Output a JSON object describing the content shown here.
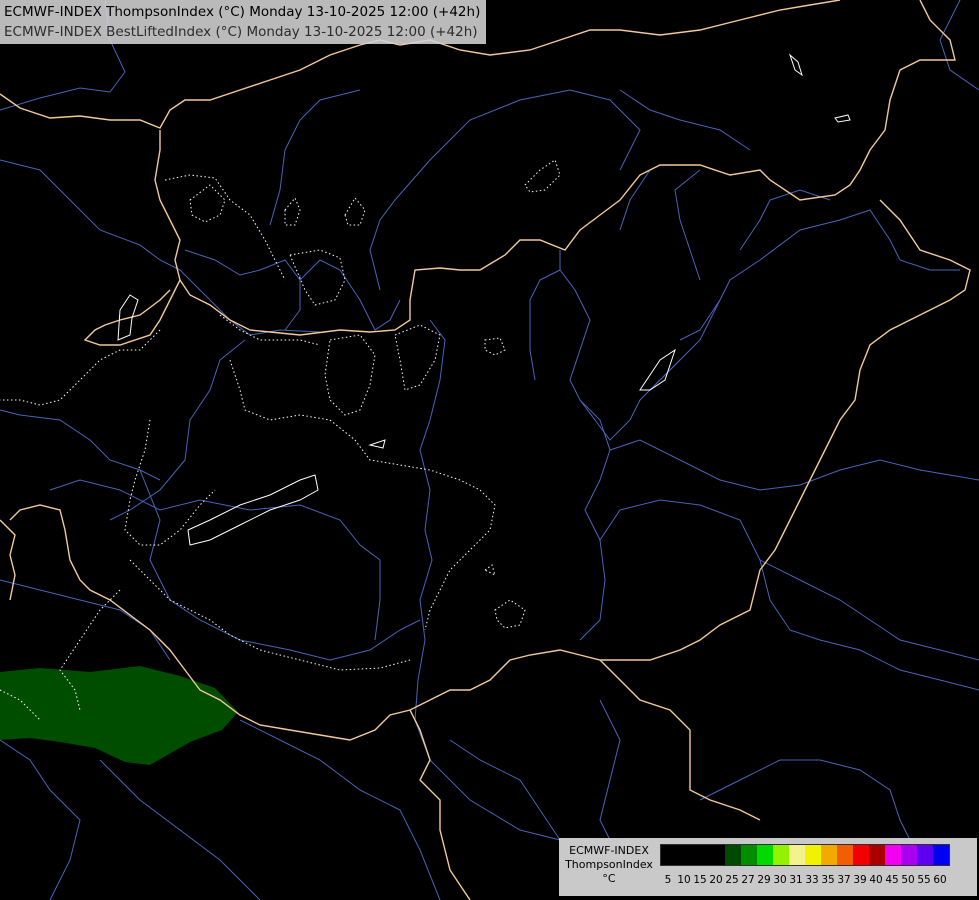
{
  "title": {
    "line1": "ECMWF-INDEX ThompsonIndex (°C) Monday 13-10-2025 12:00 (+42h)",
    "line2": "ECMWF-INDEX BestLiftedIndex (°C) Monday 13-10-2025 12:00 (+42h)"
  },
  "legend": {
    "model": "ECMWF-INDEX",
    "parameter": "ThompsonIndex",
    "unit": "°C",
    "classes": [
      {
        "value": "5",
        "color": "#000000"
      },
      {
        "value": "10",
        "color": "#000000"
      },
      {
        "value": "15",
        "color": "#000000"
      },
      {
        "value": "20",
        "color": "#000000"
      },
      {
        "value": "25",
        "color": "#004d00"
      },
      {
        "value": "27",
        "color": "#009600"
      },
      {
        "value": "29",
        "color": "#00e600"
      },
      {
        "value": "30",
        "color": "#9bff00"
      },
      {
        "value": "31",
        "color": "#ffff96"
      },
      {
        "value": "33",
        "color": "#ffff00"
      },
      {
        "value": "35",
        "color": "#ffb400"
      },
      {
        "value": "37",
        "color": "#ff6400"
      },
      {
        "value": "39",
        "color": "#ff0000"
      },
      {
        "value": "40",
        "color": "#b40000"
      },
      {
        "value": "45",
        "color": "#ff00ff"
      },
      {
        "value": "50",
        "color": "#b400ff"
      },
      {
        "value": "55",
        "color": "#6400ff"
      },
      {
        "value": "60",
        "color": "#0000ff"
      }
    ]
  },
  "colors": {
    "background": "#000000",
    "border": "#f2c99a",
    "river": "#4a64b8",
    "contour": "#ffffff",
    "fill_25_27": "#004d00"
  }
}
